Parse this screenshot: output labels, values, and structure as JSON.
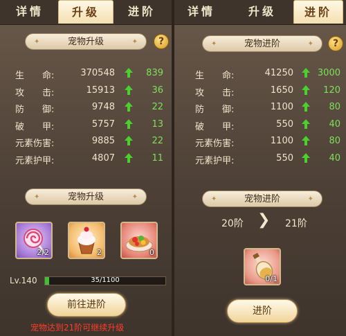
{
  "left": {
    "tabs": [
      {
        "label": "详情",
        "active": false
      },
      {
        "label": "升级",
        "active": true
      },
      {
        "label": "进阶",
        "active": false
      }
    ],
    "header_banner": "宠物升级",
    "help_glyph": "?",
    "stats": [
      {
        "name": "生　　命:",
        "value": "370548",
        "increase": "839"
      },
      {
        "name": "攻　　击:",
        "value": "15913",
        "increase": "36"
      },
      {
        "name": "防　　御:",
        "value": "9748",
        "increase": "22"
      },
      {
        "name": "破　　甲:",
        "value": "5757",
        "increase": "13"
      },
      {
        "name": "元素伤害:",
        "value": "9885",
        "increase": "22"
      },
      {
        "name": "元素护甲:",
        "value": "4807",
        "increase": "11"
      }
    ],
    "items_banner": "宠物升级",
    "items": [
      {
        "icon": "lollipop-icon",
        "count": "2/2"
      },
      {
        "icon": "cupcake-icon",
        "count": "2"
      },
      {
        "icon": "fruit-tart-icon",
        "count": "0"
      }
    ],
    "level_label": "Lv.140",
    "xp_text": "35/1100",
    "xp_fraction": 0.032,
    "goto_button": "前往进阶",
    "warning": "宠物达到21阶可继续升级"
  },
  "right": {
    "tabs": [
      {
        "label": "详情",
        "active": false
      },
      {
        "label": "升级",
        "active": false
      },
      {
        "label": "进阶",
        "active": true
      }
    ],
    "header_banner": "宠物进阶",
    "help_glyph": "?",
    "stats": [
      {
        "name": "生　　命:",
        "value": "41250",
        "increase": "3000"
      },
      {
        "name": "攻　　击:",
        "value": "1650",
        "increase": "120"
      },
      {
        "name": "防　　御:",
        "value": "1100",
        "increase": "80"
      },
      {
        "name": "破　　甲:",
        "value": "550",
        "increase": "40"
      },
      {
        "name": "元素伤害:",
        "value": "1100",
        "increase": "80"
      },
      {
        "name": "元素护甲:",
        "value": "550",
        "increase": "40"
      }
    ],
    "advance_banner": "宠物进阶",
    "stage_from": "20阶",
    "stage_to": "21阶",
    "material": {
      "icon": "potion-bottle-icon",
      "count": "0/1"
    },
    "advance_button": "进阶"
  },
  "colors": {
    "increase_green": "#7ee05a",
    "warning_red": "#ff3d2a",
    "arrow_green": "#4ccf2f"
  }
}
